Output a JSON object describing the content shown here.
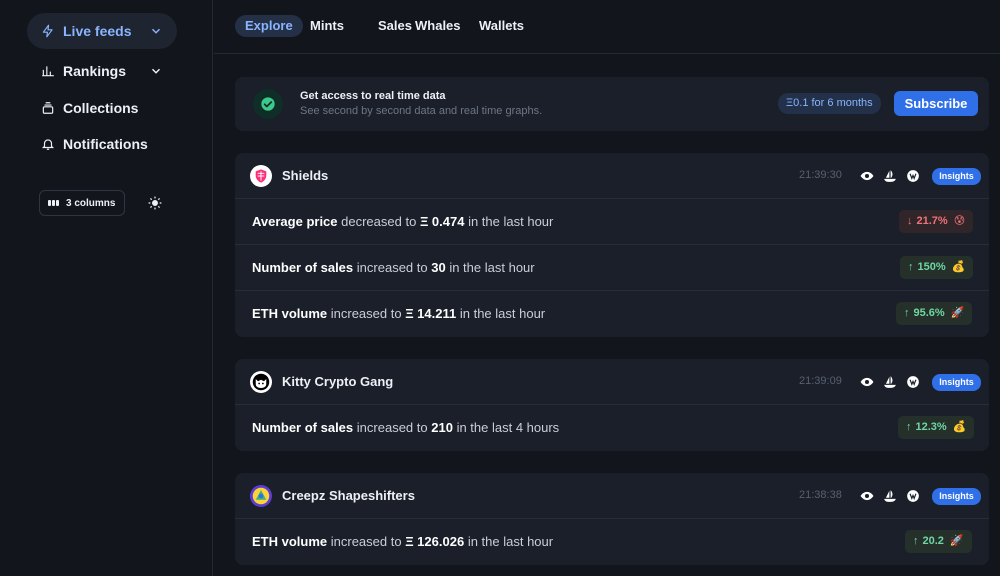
{
  "sidebar": {
    "items": [
      {
        "label": "Live feeds",
        "icon": "bolt-icon"
      },
      {
        "label": "Rankings",
        "icon": "bar-chart-icon"
      },
      {
        "label": "Collections",
        "icon": "stack-icon"
      },
      {
        "label": "Notifications",
        "icon": "bell-icon"
      }
    ],
    "columns_label": "3 columns"
  },
  "tabs": [
    "Explore",
    "Mints",
    "Sales",
    "Whales",
    "Wallets"
  ],
  "banner": {
    "title": "Get access to real time data",
    "subtitle": "See second by second data and real time graphs.",
    "price": "Ξ0.1 for 6 months",
    "subscribe": "Subscribe"
  },
  "cards": [
    {
      "name": "Shields",
      "time": "21:39:30",
      "insights": "Insights",
      "rows": [
        {
          "metric": "Average price",
          "verb": "decreased to",
          "value": "Ξ 0.474",
          "period": "in the last hour",
          "change": "21.7%",
          "direction": "down",
          "emoji": "😰"
        },
        {
          "metric": "Number of sales",
          "verb": "increased to",
          "value": "30",
          "period": "in the last hour",
          "change": "150%",
          "direction": "up",
          "emoji": "💰"
        },
        {
          "metric": "ETH volume",
          "verb": "increased to",
          "value": "Ξ 14.211",
          "period": "in the last hour",
          "change": "95.6%",
          "direction": "up",
          "emoji": "🚀"
        }
      ]
    },
    {
      "name": "Kitty Crypto Gang",
      "time": "21:39:09",
      "insights": "Insights",
      "rows": [
        {
          "metric": "Number of sales",
          "verb": "increased to",
          "value": "210",
          "period": "in the last 4 hours",
          "change": "12.3%",
          "direction": "up",
          "emoji": "💰"
        }
      ]
    },
    {
      "name": "Creepz Shapeshifters",
      "time": "21:38:38",
      "insights": "Insights",
      "rows": [
        {
          "metric": "ETH volume",
          "verb": "increased to",
          "value": "Ξ 126.026",
          "period": "in the last hour",
          "change": "20.2",
          "direction": "up",
          "emoji": "🚀"
        }
      ]
    }
  ],
  "colors": {
    "background": "#12151c",
    "panel": "#1a1f29",
    "accent": "#2f6fe8",
    "up": "#6fd6a3",
    "down": "#f0727a"
  }
}
